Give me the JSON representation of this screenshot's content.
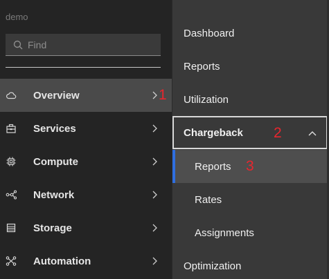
{
  "env_label": "demo",
  "search": {
    "placeholder": "Find",
    "icon": "search-icon"
  },
  "nav": [
    {
      "label": "Overview",
      "icon": "cloud-icon",
      "active": true
    },
    {
      "label": "Services",
      "icon": "services-icon"
    },
    {
      "label": "Compute",
      "icon": "chip-icon"
    },
    {
      "label": "Network",
      "icon": "network-icon"
    },
    {
      "label": "Storage",
      "icon": "storage-icon"
    },
    {
      "label": "Automation",
      "icon": "automation-icon"
    }
  ],
  "flyout": {
    "items": [
      {
        "label": "Dashboard"
      },
      {
        "label": "Reports"
      },
      {
        "label": "Utilization"
      },
      {
        "label": "Chargeback",
        "expanded": true
      },
      {
        "label": "Reports",
        "selected": true
      },
      {
        "label": "Rates"
      },
      {
        "label": "Assignments"
      },
      {
        "label": "Optimization"
      }
    ]
  },
  "annotations": [
    "1",
    "2",
    "3"
  ],
  "colors": {
    "accent": "#2f6fe0",
    "annotation": "#e8262e"
  }
}
